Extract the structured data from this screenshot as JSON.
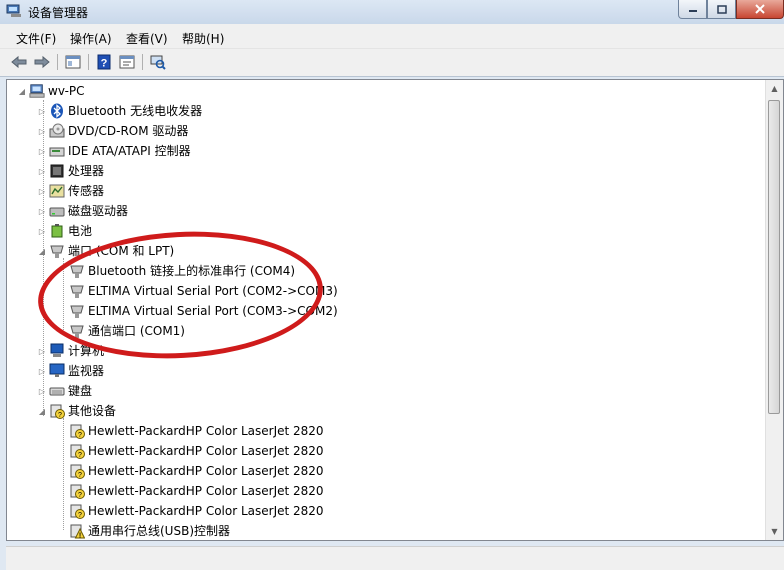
{
  "window": {
    "title": "设备管理器"
  },
  "menu": [
    "文件(F)",
    "操作(A)",
    "查看(V)",
    "帮助(H)"
  ],
  "tree": {
    "root": {
      "label": "wv-PC",
      "icon": "computer-icon"
    },
    "items": [
      {
        "label": "Bluetooth 无线电收发器",
        "icon": "bluetooth-icon",
        "level": 1,
        "expanded": false
      },
      {
        "label": "DVD/CD-ROM 驱动器",
        "icon": "dvd-drive-icon",
        "level": 1,
        "expanded": false
      },
      {
        "label": "IDE ATA/ATAPI 控制器",
        "icon": "ide-controller-icon",
        "level": 1,
        "expanded": false
      },
      {
        "label": "处理器",
        "icon": "processor-icon",
        "level": 1,
        "expanded": false
      },
      {
        "label": "传感器",
        "icon": "sensor-icon",
        "level": 1,
        "expanded": false
      },
      {
        "label": "磁盘驱动器",
        "icon": "disk-drive-icon",
        "level": 1,
        "expanded": false
      },
      {
        "label": "电池",
        "icon": "battery-icon",
        "level": 1,
        "expanded": false
      },
      {
        "label": "端口 (COM 和 LPT)",
        "icon": "port-icon",
        "level": 1,
        "expanded": true
      },
      {
        "label": "Bluetooth 链接上的标准串行 (COM4)",
        "icon": "port-icon",
        "level": 2
      },
      {
        "label": "ELTIMA Virtual Serial Port (COM2->COM3)",
        "icon": "port-icon",
        "level": 2
      },
      {
        "label": "ELTIMA Virtual Serial Port (COM3->COM2)",
        "icon": "port-icon",
        "level": 2
      },
      {
        "label": "通信端口 (COM1)",
        "icon": "port-icon",
        "level": 2
      },
      {
        "label": "计算机",
        "icon": "computer-icon",
        "level": 1,
        "expanded": false
      },
      {
        "label": "监视器",
        "icon": "monitor-icon",
        "level": 1,
        "expanded": false
      },
      {
        "label": "键盘",
        "icon": "keyboard-icon",
        "level": 1,
        "expanded": false
      },
      {
        "label": "其他设备",
        "icon": "unknown-device-icon",
        "level": 1,
        "expanded": true
      },
      {
        "label": "Hewlett-PackardHP Color LaserJet 2820",
        "icon": "unknown-device-icon",
        "level": 2
      },
      {
        "label": "Hewlett-PackardHP Color LaserJet 2820",
        "icon": "unknown-device-icon",
        "level": 2
      },
      {
        "label": "Hewlett-PackardHP Color LaserJet 2820",
        "icon": "unknown-device-icon",
        "level": 2
      },
      {
        "label": "Hewlett-PackardHP Color LaserJet 2820",
        "icon": "unknown-device-icon",
        "level": 2
      },
      {
        "label": "Hewlett-PackardHP Color LaserJet 2820",
        "icon": "unknown-device-icon",
        "level": 2
      },
      {
        "label": "通用串行总线(USB)控制器",
        "icon": "warning-device-icon",
        "level": 2
      }
    ]
  },
  "colors": {
    "annotation": "#cf1b1b",
    "titlebar": "#c9d8ea",
    "help": "#1f4fb4"
  }
}
